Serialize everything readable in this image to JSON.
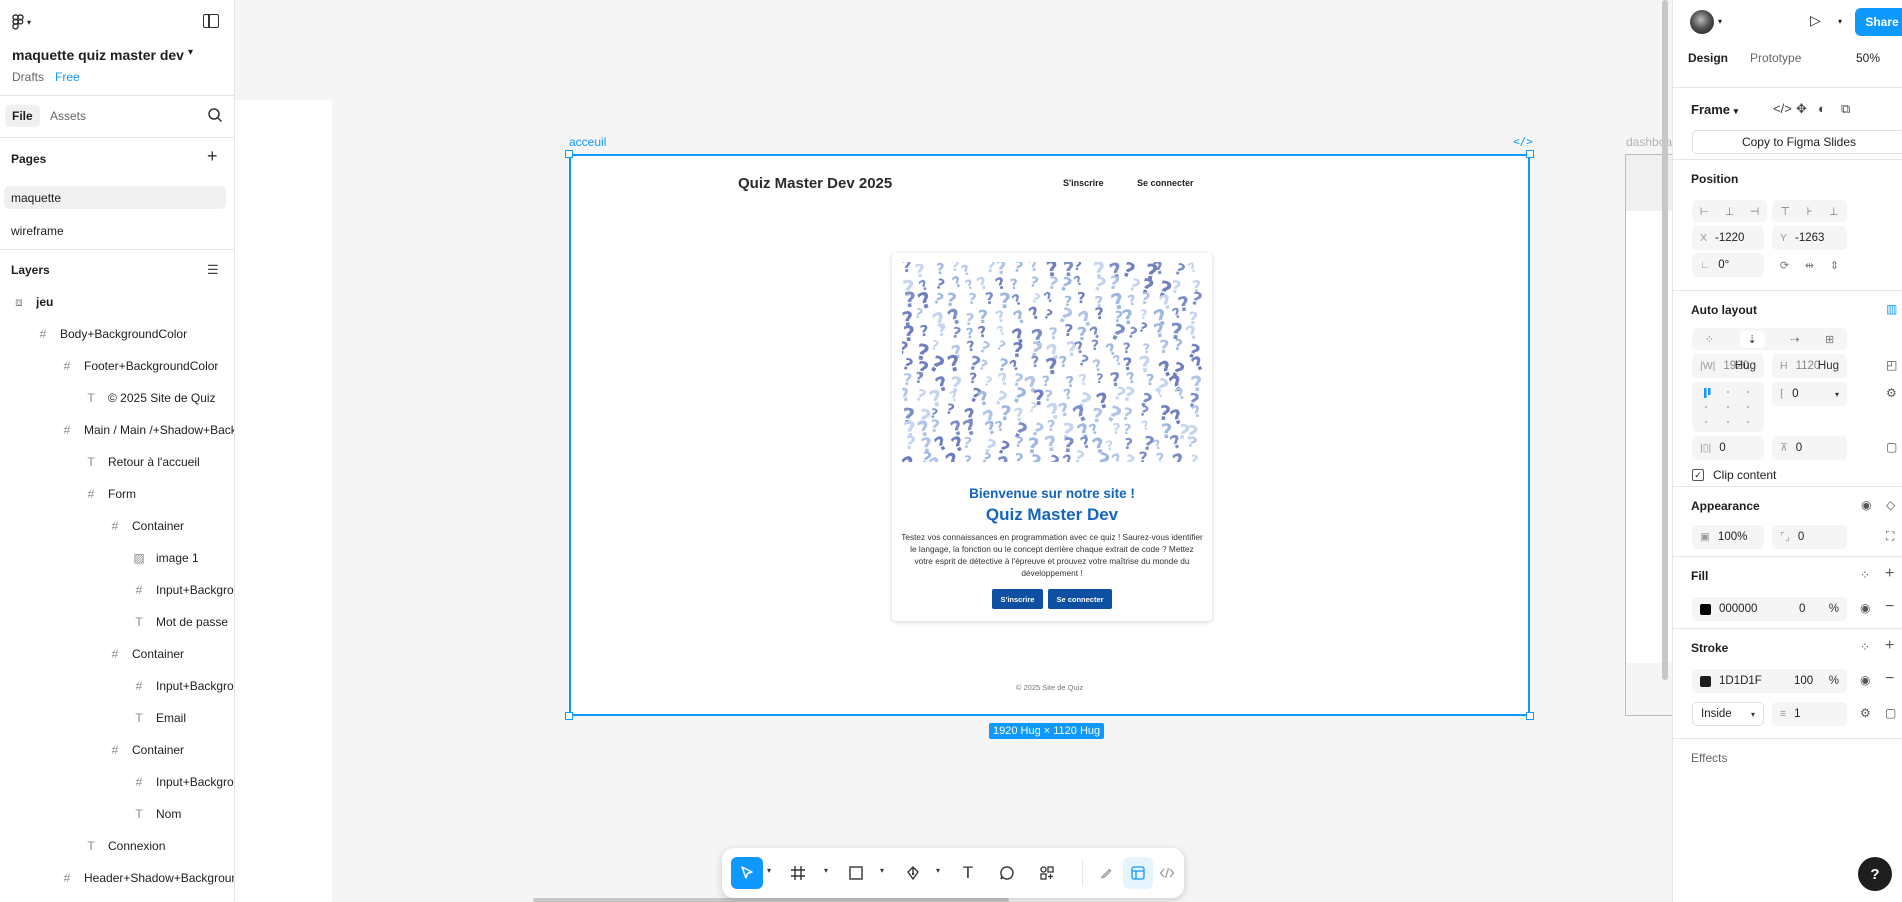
{
  "file": {
    "title": "maquette quiz master dev",
    "location": "Drafts",
    "plan": "Free"
  },
  "left_tabs": {
    "file": "File",
    "assets": "Assets"
  },
  "pages": {
    "title": "Pages",
    "items": [
      "maquette",
      "wireframe"
    ]
  },
  "layers": {
    "title": "Layers",
    "items": [
      {
        "label": "jeu",
        "icon": "component-icon"
      },
      {
        "label": "Body+BackgroundColor",
        "icon": "frame-icon"
      },
      {
        "label": "Footer+BackgroundColor",
        "icon": "frame-icon"
      },
      {
        "label": "© 2025 Site de Quiz",
        "icon": "text-icon"
      },
      {
        "label": "Main / Main /+Shadow+BackgroundColor",
        "icon": "frame-icon"
      },
      {
        "label": "Retour à l'accueil",
        "icon": "text-icon"
      },
      {
        "label": "Form",
        "icon": "frame-icon"
      },
      {
        "label": "Container",
        "icon": "frame-icon"
      },
      {
        "label": "image 1",
        "icon": "image-icon"
      },
      {
        "label": "Input+Background",
        "icon": "frame-icon"
      },
      {
        "label": "Mot de passe",
        "icon": "text-icon"
      },
      {
        "label": "Container",
        "icon": "frame-icon"
      },
      {
        "label": "Input+Background",
        "icon": "frame-icon"
      },
      {
        "label": "Email",
        "icon": "text-icon"
      },
      {
        "label": "Container",
        "icon": "frame-icon"
      },
      {
        "label": "Input+Background",
        "icon": "frame-icon"
      },
      {
        "label": "Nom",
        "icon": "text-icon"
      },
      {
        "label": "Connexion",
        "icon": "text-icon"
      },
      {
        "label": "Header+Shadow+BackgroundColor",
        "icon": "frame-icon"
      }
    ]
  },
  "canvas": {
    "frame_label": "acceuil",
    "frame_code_tag": "</>",
    "next_frame_label": "dashboard",
    "size_label": "1920 Hug × 1120 Hug",
    "site": {
      "title": "Quiz Master Dev 2025",
      "nav_signup": "S'inscrire",
      "nav_login": "Se connecter",
      "welcome": "Bienvenue sur notre site !",
      "heading": "Quiz Master Dev",
      "description": "Testez vos connaissances en programmation avec ce quiz ! Saurez-vous identifier le langage, la fonction ou le concept derrière chaque extrait de code ? Mettez votre esprit de détective à l'épreuve et prouvez votre maîtrise du monde du développement !",
      "btn_signup": "S'inscrire",
      "btn_login": "Se connecter",
      "footer": "© 2025 Site de Quiz"
    }
  },
  "toolbar": {
    "tools": [
      "move-tool",
      "frame-tool",
      "shape-tool",
      "pen-tool",
      "text-tool",
      "comment-tool",
      "actions-tool",
      "draw-mode",
      "design-mode",
      "dev-mode"
    ]
  },
  "right": {
    "tabs": {
      "design": "Design",
      "prototype": "Prototype"
    },
    "zoom": "50%",
    "share": "Share",
    "frame_type": "Frame",
    "copy_slides": "Copy to Figma Slides",
    "position": {
      "title": "Position",
      "x_label": "X",
      "x": "-1220",
      "y_label": "Y",
      "y": "-1263",
      "rotation": "0°"
    },
    "auto_layout": {
      "title": "Auto layout",
      "w_value": "1920",
      "w_mode": "Hug",
      "h_label": "H",
      "h_value": "1120",
      "h_mode": "Hug",
      "gap": "0",
      "padding_h": "0",
      "padding_v": "0",
      "clip": "Clip content"
    },
    "appearance": {
      "title": "Appearance",
      "opacity": "100%",
      "radius": "0"
    },
    "fill": {
      "title": "Fill",
      "color": "000000",
      "opacity": "0",
      "unit": "%",
      "swatch_color": "#000000"
    },
    "stroke": {
      "title": "Stroke",
      "color": "1D1D1F",
      "opacity": "100",
      "unit": "%",
      "position": "Inside",
      "weight": "1",
      "swatch_color": "#1D1D1F"
    },
    "effects": {
      "title": "Effects"
    }
  },
  "colors": {
    "accent": "#0d99ff",
    "site_blue": "#1565c0",
    "button_blue": "#0d4fa3"
  }
}
